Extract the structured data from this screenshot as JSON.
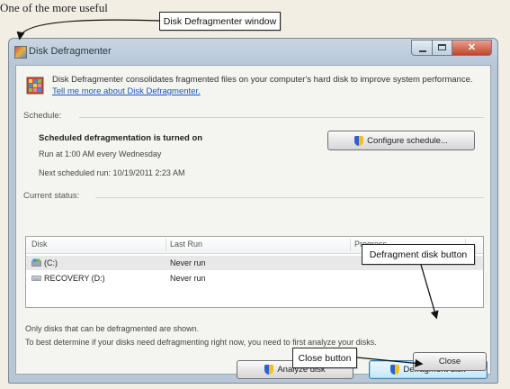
{
  "headline": "One of the more useful",
  "callouts": {
    "window": "Disk Defragmenter window",
    "defragment": "Defragment disk button",
    "close": "Close button"
  },
  "window": {
    "title": "Disk Defragmenter",
    "description": "Disk Defragmenter consolidates fragmented files on your computer's hard disk to improve system performance.",
    "link": "Tell me more about Disk Defragmenter.",
    "schedule_label": "Schedule:",
    "schedule_status": "Scheduled defragmentation is turned on",
    "run_at": "Run at 1:00 AM every Wednesday",
    "next_run": "Next scheduled run: 10/19/2011 2:23 AM",
    "configure_button": "Configure schedule...",
    "current_status_label": "Current status:",
    "columns": [
      "Disk",
      "Last Run",
      "Progress"
    ],
    "disks": [
      {
        "name": "(C:)",
        "last_run": "Never run",
        "progress": ""
      },
      {
        "name": "RECOVERY (D:)",
        "last_run": "Never run",
        "progress": ""
      }
    ],
    "note_line1": "Only disks that can be defragmented are shown.",
    "note_line2": "To best determine if your disks need defragmenting right now, you need to first analyze your disks.",
    "analyze_button": "Analyze disk",
    "defragment_button": "Defragment disk",
    "close_button": "Close"
  },
  "icons": [
    "disk-defragmenter-icon",
    "shield-icon",
    "hard-drive-icon",
    "minimize-icon",
    "maximize-icon",
    "close-x-icon"
  ]
}
